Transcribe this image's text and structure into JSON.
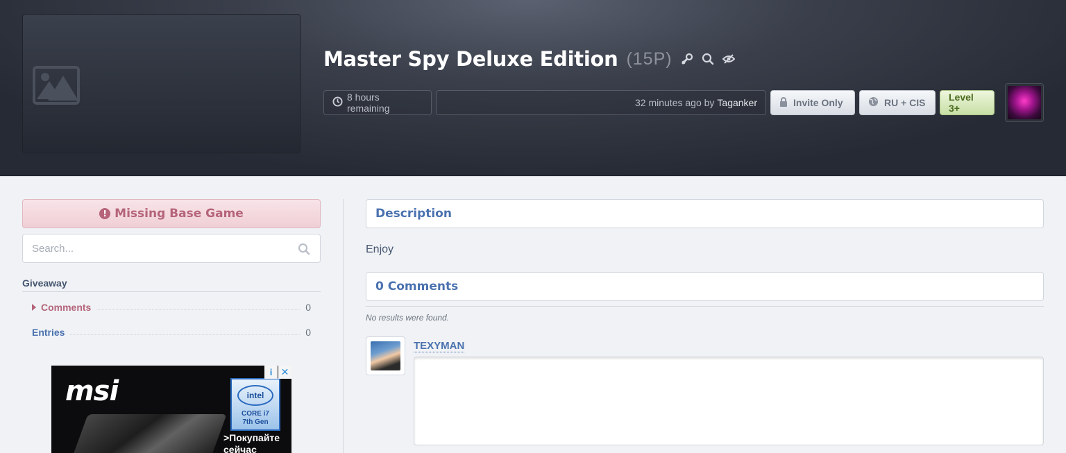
{
  "header": {
    "title": "Master Spy Deluxe Edition",
    "points": "(15P)",
    "time_remaining": "8 hours remaining",
    "created_ago": "32 minutes ago by",
    "creator": "Taganker",
    "badges": {
      "invite": "Invite Only",
      "region": "RU + CIS",
      "level": "Level 3+"
    }
  },
  "sidebar": {
    "missing_game": "Missing Base Game",
    "search_placeholder": "Search...",
    "heading": "Giveaway",
    "items": [
      {
        "label": "Comments",
        "count": "0"
      },
      {
        "label": "Entries",
        "count": "0"
      }
    ]
  },
  "ad": {
    "brand": "msi",
    "badge_brand": "intel",
    "badge_line1": "CORE i7",
    "badge_line2": "7th Gen",
    "cta_line1": ">Покупайте",
    "cta_line2": "сейчас",
    "info_glyph": "i",
    "close_glyph": "✕"
  },
  "main": {
    "description_heading": "Description",
    "description_text": "Enjoy",
    "comments_heading": "0 Comments",
    "no_results": "No results were found.",
    "username": "TEXYMAN"
  }
}
